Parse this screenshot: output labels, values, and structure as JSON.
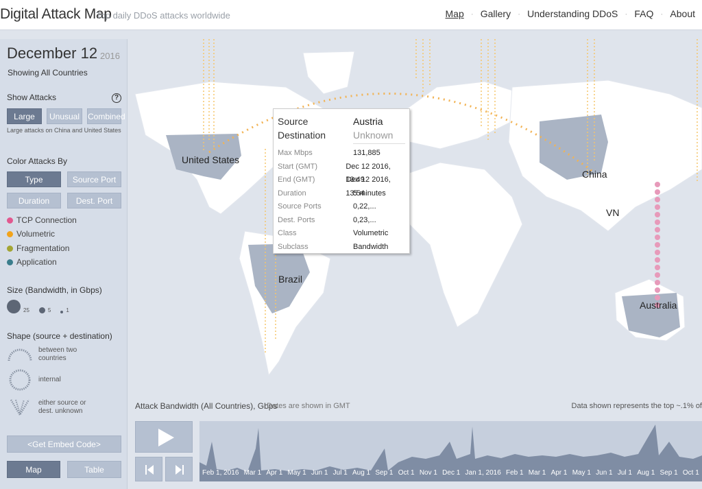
{
  "header": {
    "brand": "Digital Attack Map",
    "tagline": "Top daily DDoS attacks worldwide",
    "nav": [
      "Map",
      "Gallery",
      "Understanding DDoS",
      "FAQ",
      "About"
    ]
  },
  "sidebar": {
    "date": "December 12",
    "year": "2016",
    "showing": "Showing All Countries",
    "show_attacks_label": "Show Attacks",
    "help": "?",
    "attack_buttons": [
      "Large",
      "Unusual",
      "Combined"
    ],
    "large_note": "Large attacks on China and United States",
    "color_label": "Color Attacks By",
    "color_buttons": [
      "Type",
      "Source Port",
      "Duration",
      "Dest. Port"
    ],
    "legend": [
      {
        "label": "TCP Connection",
        "color": "#e2588f"
      },
      {
        "label": "Volumetric",
        "color": "#f2a31b"
      },
      {
        "label": "Fragmentation",
        "color": "#a3a534"
      },
      {
        "label": "Application",
        "color": "#3a7d8c"
      }
    ],
    "size_label": "Size (Bandwidth, in Gbps)",
    "sizes": [
      "25",
      "5",
      "1"
    ],
    "shape_label": "Shape (source + destination)",
    "shapes": [
      "between two countries",
      "internal",
      "either source or dest. unknown"
    ],
    "embed_button": "<Get Embed Code>",
    "view_buttons": [
      "Map",
      "Table"
    ]
  },
  "map": {
    "countries": [
      "United States",
      "China",
      "VN",
      "Brazil",
      "Australia"
    ]
  },
  "tooltip": {
    "source_label": "Source",
    "source": "Austria",
    "destination_label": "Destination",
    "destination": "Unknown",
    "rows": [
      {
        "k": "Max Mbps",
        "v": "131,885"
      },
      {
        "k": "Start (GMT)",
        "v": "Dec 12 2016, 13:49"
      },
      {
        "k": "End (GMT)",
        "v": "Dec 12 2016, 13:54"
      },
      {
        "k": "Duration",
        "v": "5 minutes"
      },
      {
        "k": "Source Ports",
        "v": "0,22,..."
      },
      {
        "k": "Dest. Ports",
        "v": "0,23,..."
      },
      {
        "k": "Class",
        "v": "Volumetric"
      },
      {
        "k": "Subclass",
        "v": "Bandwidth"
      }
    ]
  },
  "timeline": {
    "title": "Attack Bandwidth (All Countries), Gbps",
    "note": "Dates are shown in GMT",
    "data_shown": "Data shown represents the top ~.1% of",
    "months": [
      "Feb 1, 2016",
      "Mar 1",
      "Apr 1",
      "May 1",
      "Jun 1",
      "Jul 1",
      "Aug 1",
      "Sep 1",
      "Oct 1",
      "Nov 1",
      "Dec 1",
      "Jan 1, 2016",
      "Feb 1",
      "Mar 1",
      "Apr 1",
      "May 1",
      "Jun 1",
      "Jul 1",
      "Aug 1",
      "Sep 1",
      "Oct 1"
    ]
  }
}
